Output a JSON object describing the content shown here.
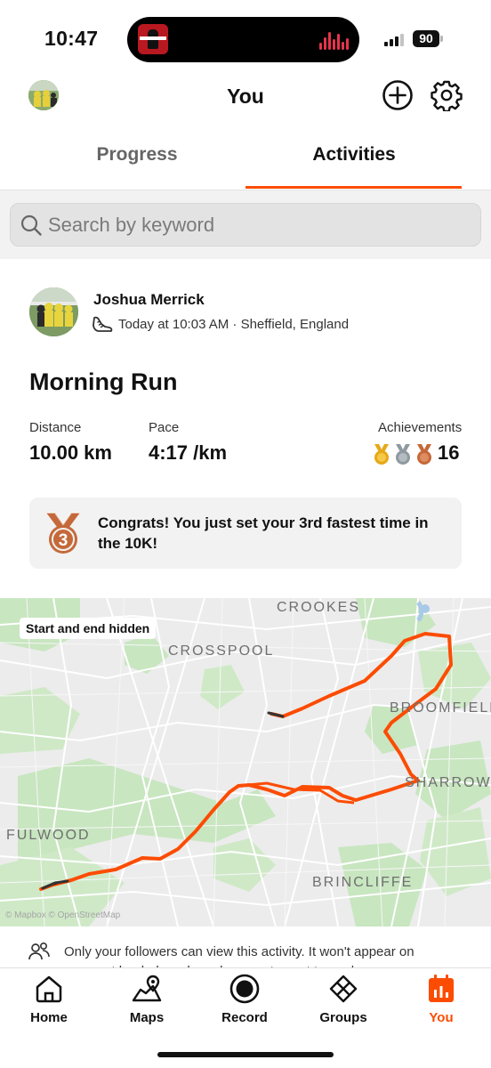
{
  "status_bar": {
    "time": "10:47",
    "battery": "90"
  },
  "header": {
    "title": "You"
  },
  "tabs": [
    {
      "label": "Progress"
    },
    {
      "label": "Activities"
    }
  ],
  "search": {
    "placeholder": "Search by keyword"
  },
  "activity": {
    "athlete": "Joshua Merrick",
    "meta": "Today at 10:03 AM · Sheffield, England",
    "title": "Morning Run",
    "stats": {
      "distance_label": "Distance",
      "distance": "10.00 km",
      "pace_label": "Pace",
      "pace": "4:17 /km",
      "achievements_label": "Achievements",
      "achievements": "16"
    },
    "congrats": "Congrats! You just set your 3rd fastest time in the 10K!",
    "medal_rank": "3"
  },
  "map": {
    "badge": "Start and end hidden",
    "labels": [
      "CROOKES",
      "CROSSPOOL",
      "BROOMFIELD",
      "SHARROW",
      "FULWOOD",
      "BRINCLIFFE"
    ],
    "attribution": "© Mapbox © OpenStreetMap",
    "route_color": "#fc4c02"
  },
  "privacy": "Only your followers can view this activity. It won't appear on segment leaderboards and may not count toward some challenges.",
  "nav": [
    {
      "label": "Home",
      "icon": "home-icon"
    },
    {
      "label": "Maps",
      "icon": "maps-icon"
    },
    {
      "label": "Record",
      "icon": "record-icon"
    },
    {
      "label": "Groups",
      "icon": "groups-icon"
    },
    {
      "label": "You",
      "icon": "you-icon"
    }
  ],
  "colors": {
    "accent": "#fc4c02",
    "gold": "#e6a817",
    "silver": "#8f9aa0",
    "bronze": "#c5693a"
  }
}
